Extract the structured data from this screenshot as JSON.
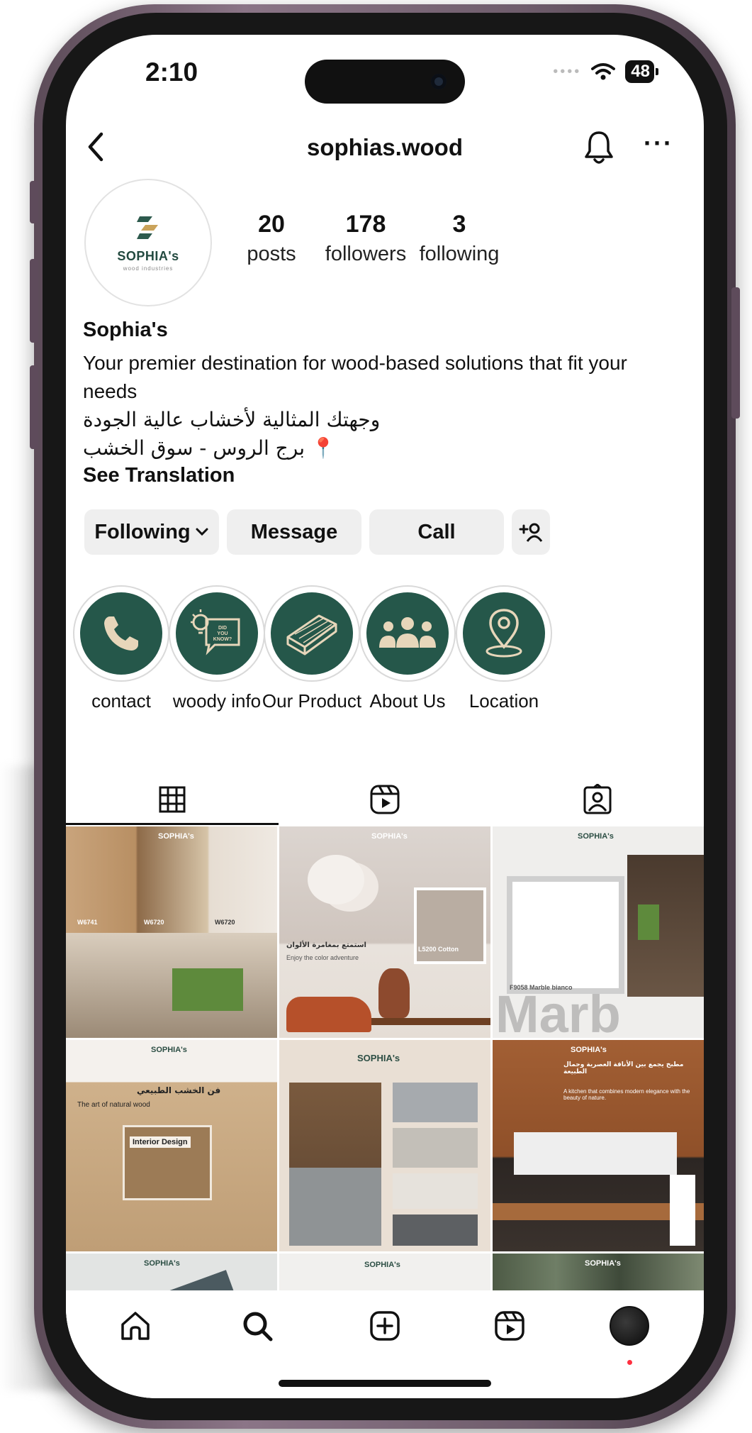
{
  "status_bar": {
    "time": "2:10",
    "battery": "48"
  },
  "header": {
    "username": "sophias.wood"
  },
  "profile": {
    "avatar_brand": "SOPHIA's",
    "avatar_sub": "wood industries",
    "stats": [
      {
        "value": "20",
        "label": "posts"
      },
      {
        "value": "178",
        "label": "followers"
      },
      {
        "value": "3",
        "label": "following"
      }
    ],
    "name": "Sophia's",
    "bio_en": "Your premier destination for wood-based solutions that fit your needs",
    "bio_ar": "وجهتك المثالية لأخشاب عالية الجودة",
    "location": "📍 برج الروس - سوق الخشب",
    "see_translation": "See Translation"
  },
  "actions": {
    "following": "Following",
    "message": "Message",
    "call": "Call"
  },
  "highlights": [
    {
      "label": "contact",
      "icon": "phone-icon"
    },
    {
      "label": "woody info",
      "icon": "lightbulb-chat-icon",
      "badge": "DID YOU KNOW?"
    },
    {
      "label": "Our Product",
      "icon": "wood-planks-icon"
    },
    {
      "label": "About Us",
      "icon": "group-icon"
    },
    {
      "label": "Location",
      "icon": "location-pin-icon"
    }
  ],
  "tabs": [
    "grid-icon",
    "reels-icon",
    "tagged-icon"
  ],
  "posts": {
    "p1": {
      "codes": [
        "W6741",
        "W6720",
        "W6720"
      ]
    },
    "p2": {
      "swatch": "L5200 Cotton",
      "ar": "استمتع بمغامرة الألوان",
      "en": "Enjoy the color adventure"
    },
    "p3": {
      "code": "F9058 Marble bianco",
      "big": "Marb"
    },
    "p4": {
      "ar": "فن الخشب الطبيعي",
      "en": "The art of natural wood",
      "label": "Interior Design"
    },
    "p6": {
      "ar": "مطبخ يجمع بين الأناقة العصرية وجمال الطبيعة",
      "en": "A kitchen that combines modern elegance with the beauty of nature."
    },
    "logo": "SOPHIA's"
  },
  "colors": {
    "brand_green": "#25574a",
    "text": "#111111",
    "button_bg": "#efefef"
  }
}
